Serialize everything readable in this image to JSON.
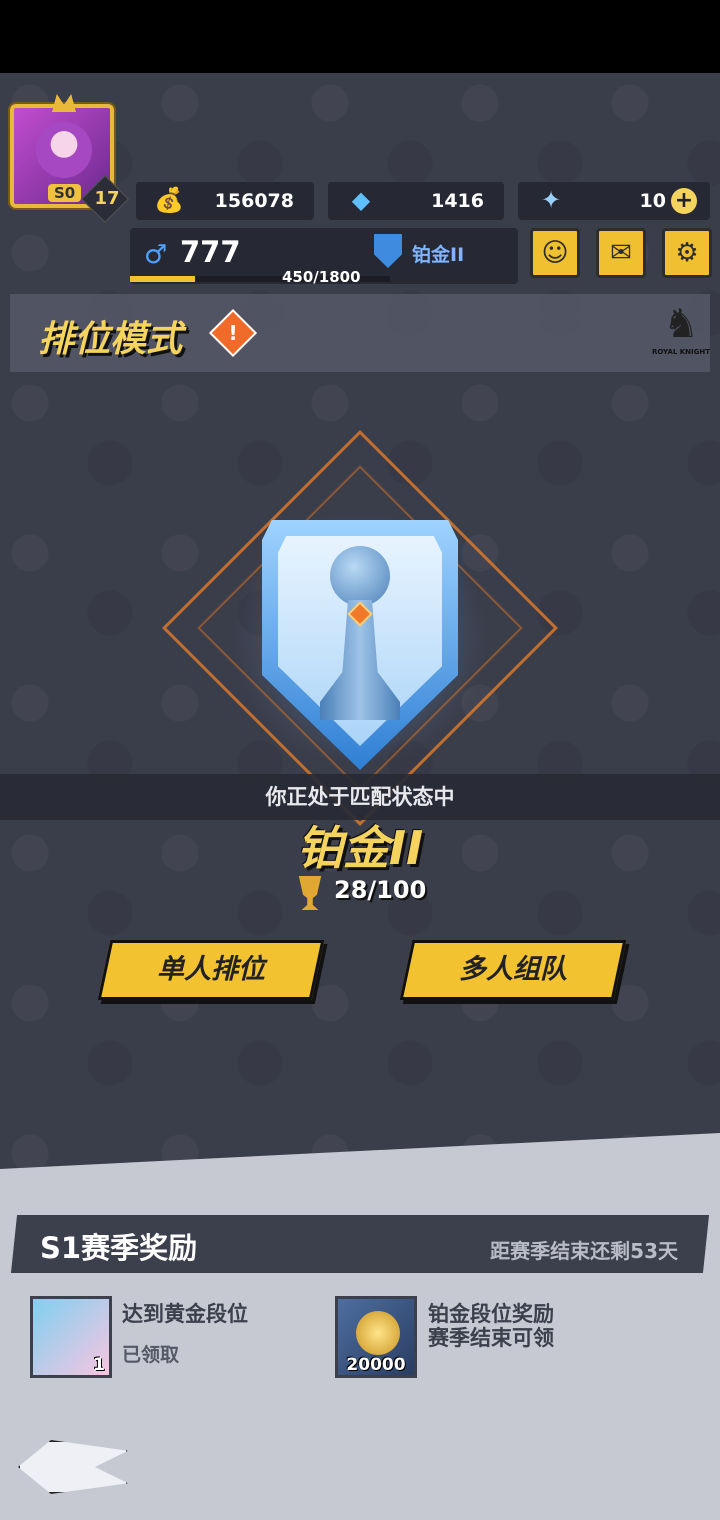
{
  "player": {
    "season_badge": "S0",
    "level": "17"
  },
  "resources": {
    "gold": "156078",
    "gems": "1416",
    "tickets": "10",
    "add_symbol": "+"
  },
  "exp": {
    "value": "777",
    "progress_text": "450/1800",
    "progress_fraction": 0.25
  },
  "rank_small": "铂金II",
  "mode": {
    "title": "排位模式",
    "warning_symbol": "!",
    "logo_text": "ROYAL KNIGHT"
  },
  "status": {
    "matching": "你正处于匹配状态中",
    "rank_name": "铂金II",
    "trophy_progress": "28/100"
  },
  "actions": {
    "solo": "单人排位",
    "team": "多人组队"
  },
  "season": {
    "title": "S1赛季奖励",
    "remaining": "距赛季结束还剩53天",
    "rewards": [
      {
        "qty": "1",
        "label": "达到黄金段位",
        "sub": "已领取"
      },
      {
        "qty": "20000",
        "label": "铂金段位奖励",
        "sub": "赛季结束可领"
      }
    ]
  },
  "icons": {
    "gold": "gold-bag-icon",
    "gem": "diamond-icon",
    "ticket": "ticket-icon",
    "friends": "friends-icon",
    "mail": "mail-icon",
    "settings": "gear-icon",
    "exp": "exp-icon",
    "back": "back-arrow-icon"
  },
  "colors": {
    "accent": "#f2c230",
    "background": "#3a3d4a",
    "rank_blue": "#3f8be0"
  }
}
